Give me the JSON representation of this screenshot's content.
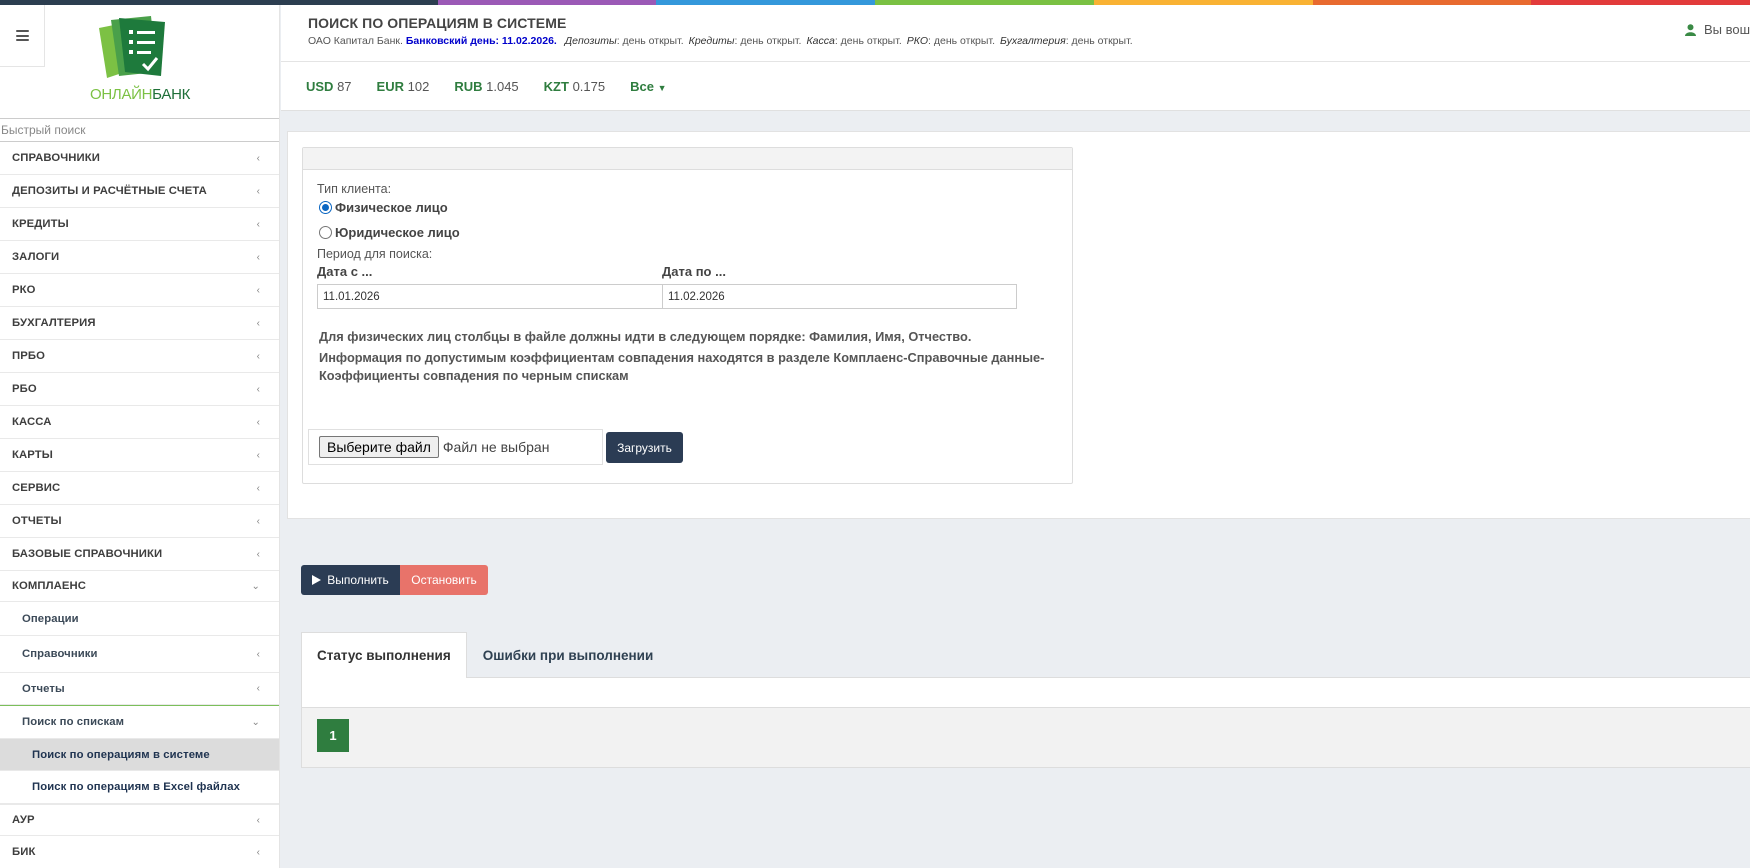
{
  "colors": {
    "stripe": [
      "#2c3e50",
      "#2c3e50",
      "#9b59b6",
      "#3498db",
      "#7ac143",
      "#f9b233",
      "#e86a2f",
      "#e23b3b"
    ],
    "brand_green": "#2f7d3f",
    "dark_button": "#2b3c54",
    "stop_button": "#e8736a",
    "bank_day": "#0000cc"
  },
  "logo": {
    "text_part1": "ОНЛАЙН",
    "text_part2": "БАНК"
  },
  "sidebar": {
    "burger_icon": "hamburger-menu-icon",
    "search_placeholder": "Быстрый поиск",
    "items": [
      {
        "label": "СПРАВОЧНИКИ",
        "chevron": "‹"
      },
      {
        "label": "ДЕПОЗИТЫ И РАСЧЁТНЫЕ СЧЕТА",
        "chevron": "‹"
      },
      {
        "label": "КРЕДИТЫ",
        "chevron": "‹"
      },
      {
        "label": "ЗАЛОГИ",
        "chevron": "‹"
      },
      {
        "label": "РКО",
        "chevron": "‹"
      },
      {
        "label": "БУХГАЛТЕРИЯ",
        "chevron": "‹"
      },
      {
        "label": "ПРБО",
        "chevron": "‹"
      },
      {
        "label": "РБО",
        "chevron": "‹"
      },
      {
        "label": "КАССА",
        "chevron": "‹"
      },
      {
        "label": "КАРТЫ",
        "chevron": "‹"
      },
      {
        "label": "СЕРВИС",
        "chevron": "‹"
      },
      {
        "label": "ОТЧЕТЫ",
        "chevron": "‹"
      },
      {
        "label": "БАЗОВЫЕ СПРАВОЧНИКИ",
        "chevron": "‹"
      },
      {
        "label": "КОМПЛАЕНС",
        "chevron": "⌄"
      }
    ],
    "compliance_children": [
      {
        "label": "Операции",
        "chevron": ""
      },
      {
        "label": "Справочники",
        "chevron": "‹"
      },
      {
        "label": "Отчеты",
        "chevron": "‹"
      },
      {
        "label": "Поиск по спискам",
        "chevron": "⌄"
      }
    ],
    "search_children": [
      {
        "label": "Поиск по операциям в системе"
      },
      {
        "label": "Поиск по операциям в Excel файлах"
      }
    ],
    "after_items": [
      {
        "label": "АУР",
        "chevron": "‹"
      },
      {
        "label": "БИК",
        "chevron": "‹"
      }
    ]
  },
  "header": {
    "title": "ПОИСК ПО ОПЕРАЦИЯМ В СИСТЕМЕ",
    "bank": "ОАО Капитал Банк.",
    "bank_day": "Банковский день: 11.02.2026.",
    "statuses": [
      {
        "name": "Депозиты",
        "value": ": день открыт."
      },
      {
        "name": "Кредиты",
        "value": ": день открыт."
      },
      {
        "name": "Касса",
        "value": ": день открыт."
      },
      {
        "name": "РКО",
        "value": ": день открыт."
      },
      {
        "name": "Бухгалтерия",
        "value": ": день открыт."
      }
    ],
    "user_text": "Вы вош",
    "user_icon": "user-icon"
  },
  "rates": {
    "items": [
      {
        "code": "USD",
        "value": "87"
      },
      {
        "code": "EUR",
        "value": "102"
      },
      {
        "code": "RUB",
        "value": "1.045"
      },
      {
        "code": "KZT",
        "value": "0.175"
      }
    ],
    "all_label": "Все",
    "all_icon": "caret-down-icon"
  },
  "form": {
    "client_type_label": "Тип клиента:",
    "client_types": [
      "Физическое лицо",
      "Юридическое лицо"
    ],
    "selected_client_type": "Физическое лицо",
    "period_label": "Период для поиска:",
    "date_from_label": "Дата с ...",
    "date_from_value": "11.01.2026",
    "date_to_label": "Дата по ...",
    "date_to_value": "11.02.2026",
    "note1": "Для физических лиц столбцы в файле должны идти в следующем порядке: Фамилия, Имя, Отчество.",
    "note2_line1": "Информация по допустимым коэффициентам совпадения находятся в разделе Комплаенс-Справочные данные-",
    "note2_line2": "Коэффициенты совпадения по черным спискам",
    "file_button": "Выберите файл",
    "file_none": "Файл не выбран",
    "upload_button": "Загрузить"
  },
  "actions": {
    "run_label": "Выполнить",
    "run_icon": "play-icon",
    "stop_label": "Остановить"
  },
  "tabs": {
    "items": [
      "Статус выполнения",
      "Ошибки при выполнении"
    ],
    "active": "Статус выполнения"
  },
  "pager": {
    "current_page": "1"
  }
}
